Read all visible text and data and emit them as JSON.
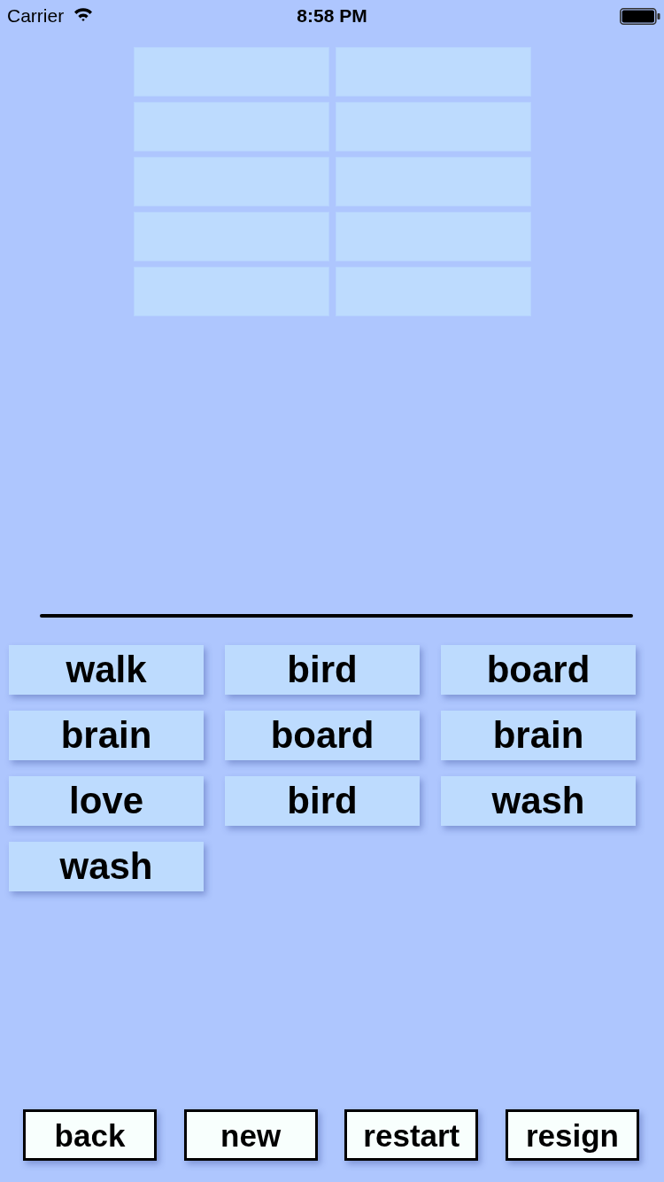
{
  "status_bar": {
    "carrier": "Carrier",
    "time": "8:58 PM"
  },
  "answer_slots": [
    {
      "filled": false
    },
    {
      "filled": false
    },
    {
      "filled": false
    },
    {
      "filled": false
    },
    {
      "filled": false
    },
    {
      "filled": false
    },
    {
      "filled": false
    },
    {
      "filled": false
    },
    {
      "filled": false
    },
    {
      "filled": false
    }
  ],
  "word_tiles": [
    {
      "word": "walk"
    },
    {
      "word": "bird"
    },
    {
      "word": "board"
    },
    {
      "word": "brain"
    },
    {
      "word": "board"
    },
    {
      "word": "brain"
    },
    {
      "word": "love"
    },
    {
      "word": "bird"
    },
    {
      "word": "wash"
    },
    {
      "word": "wash"
    }
  ],
  "buttons": [
    {
      "label": "back"
    },
    {
      "label": "new"
    },
    {
      "label": "restart"
    },
    {
      "label": "resign"
    }
  ]
}
